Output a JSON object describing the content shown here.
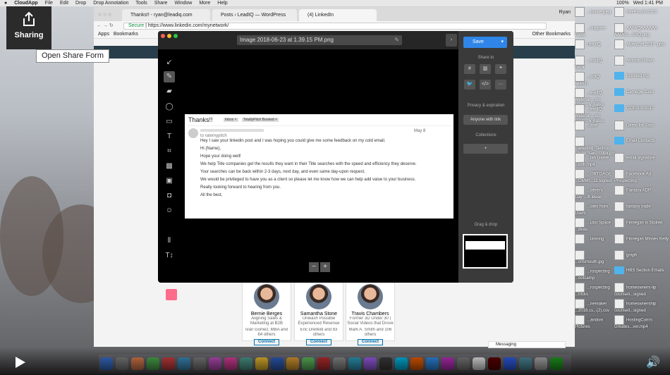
{
  "menubar": {
    "app": "CloudApp",
    "items": [
      "File",
      "Edit",
      "Drop",
      "Drop Annotation",
      "Tools",
      "Share",
      "Window",
      "More",
      "Help"
    ],
    "clock": "Wed 1:41 PM",
    "battery": "100%"
  },
  "sharing": {
    "label": "Sharing",
    "tooltip": "Open Share Form"
  },
  "browser": {
    "profile": "Ryan",
    "tabs": [
      {
        "label": "Thanks!! - ryan@leadiq.com"
      },
      {
        "label": "Posts ‹ LeadIQ — WordPress"
      },
      {
        "label": "(4) LinkedIn"
      }
    ],
    "url_secure": "Secure",
    "url": "https://www.linkedin.com/mynetwork/",
    "bookmarks": [
      "Apps",
      "Bookmarks"
    ],
    "other_bookmarks": "Other Bookmarks"
  },
  "editor": {
    "filename": "Image 2018-06-23 at 1.39.15 PM.png",
    "tools": [
      "arrow",
      "pen",
      "highlighter",
      "ellipse",
      "rectangle",
      "text",
      "crop",
      "blur",
      "pixelate",
      "spotlight",
      "emoji",
      "columns",
      "text-size"
    ],
    "zoom_out": "−",
    "zoom_in": "+",
    "email": {
      "subject": "Thanks!!",
      "tags": [
        "Inbox ×",
        "TotallyPitch Booked ×"
      ],
      "date": "May 8",
      "to": "to ratemypitch",
      "lines": [
        "Hey I saw your linkedin post and I was hoping you could give me some feedback on my cold email.",
        "Hi {Name},",
        "Hope your doing well!",
        "We help Title companies get the results they want in their Title searches with the speed and efficiency they deserve.",
        "Your searches can be back within 2-3 days, next day, and even same day-upon request.",
        "We would be privileged to have you as a client so please let me know how we can help add value to your business.",
        "Really looking forward to hearing from you.",
        "All the best,"
      ]
    },
    "panel": {
      "save": "Save",
      "share_to": "Share to",
      "privacy": "Privacy & expiration",
      "anyone": "Anyone with link",
      "collections": "Collections",
      "collections_add": "+",
      "drag": "Drag & drop",
      "share_buttons": [
        "slack",
        "trello",
        "hangouts",
        "twitter",
        "embed",
        "more"
      ],
      "embed_label": "</>",
      "more_label": "···"
    }
  },
  "linkedin": {
    "cards": [
      {
        "name": "Bernie Berges",
        "headline": "Aligning Sales & Marketing at B2B Companies | Content",
        "conn": "Ivan Gomez, MBA and 64 others",
        "btn": "Connect"
      },
      {
        "name": "Samantha Stone",
        "headline": "Unleash Possible Experienced Revenue",
        "conn": "Eric Dreifeld and 83 others",
        "btn": "Connect"
      },
      {
        "name": "Travis Chambers",
        "headline": "Former 3D Under 30 | Social Videos that Drove Millions in",
        "conn": "Mark A. Smith and 106 others",
        "btn": "Connect"
      }
    ],
    "messaging": "Messaging"
  },
  "desktop": [
    {
      "label": "...house.jpeg",
      "kind": "file"
    },
    {
      "label": "KeePassX-2.0.3",
      "kind": "file"
    },
    {
      "label": "...stagram Posts",
      "kind": "file"
    },
    {
      "label": "AAFAQAAAAAA AAPKA...SNQ.png",
      "kind": "file"
    },
    {
      "label": "LeadIQ",
      "kind": "file"
    },
    {
      "label": "AlphaLoft 2017 .pptx",
      "kind": "file"
    },
    {
      "label": "...eadIQ Deck",
      "kind": "file"
    },
    {
      "label": "Antonio Brown",
      "kind": "file"
    },
    {
      "label": "...adIQ search",
      "kind": "file"
    },
    {
      "label": "branded.mp",
      "kind": "folder"
    },
    {
      "label": "...eadIQ Webinar ...on Doub...ly Rates",
      "kind": "file"
    },
    {
      "label": "Carnegie Card",
      "kind": "folder"
    },
    {
      "label": "...eadIQ Webinar ...on Doub...ly Rates",
      "kind": "file"
    },
    {
      "label": "CCE01302017",
      "kind": "folder"
    },
    {
      "label": "...ase",
      "kind": "file"
    },
    {
      "label": "Demo for Sam",
      "kind": "file"
    },
    {
      "label": "...arketing_Techno ...logy_Lan...00px.jpg",
      "kind": "file"
    },
    {
      "label": "Email Contacts",
      "kind": "folder"
    },
    {
      "label": "...ian Game ...orth.mp4",
      "kind": "file"
    },
    {
      "label": "email signature",
      "kind": "file"
    },
    {
      "label": "...ORTGAGE ...OMMI...11 signed",
      "kind": "file"
    },
    {
      "label": "Facebook Ad Prospecting",
      "kind": "file"
    },
    {
      "label": "...other's Day ...ift ideas",
      "kind": "file"
    },
    {
      "label": "Fantasy ADP",
      "kind": "file"
    },
    {
      "label": "...otes from Users",
      "kind": "file"
    },
    {
      "label": "fantasy trade",
      "kind": "file"
    },
    {
      "label": "...utor Space ...deas",
      "kind": "file"
    },
    {
      "label": "Finnegan is Stoked",
      "kind": "file"
    },
    {
      "label": "...lanning",
      "kind": "file"
    },
    {
      "label": "Finnegan Misses Kelly",
      "kind": "file"
    },
    {
      "label": "...ortsmouth.jpg",
      "kind": "file"
    },
    {
      "label": "graph",
      "kind": "file"
    },
    {
      "label": "...rospecting ...ootcamp",
      "kind": "file"
    },
    {
      "label": "HBS Section Emails",
      "kind": "folder"
    },
    {
      "label": "...rospecting ...tricks",
      "kind": "file"
    },
    {
      "label": "homeowners-lip counseli...signed",
      "kind": "file"
    },
    {
      "label": "...nemaker ...2018.cs...(2).csv",
      "kind": "file"
    },
    {
      "label": "homeownership counseli...signed",
      "kind": "file"
    },
    {
      "label": "...andom Pictures",
      "kind": "file"
    },
    {
      "label": "HostingCom's Greates...ver.mp4",
      "kind": "file"
    }
  ]
}
